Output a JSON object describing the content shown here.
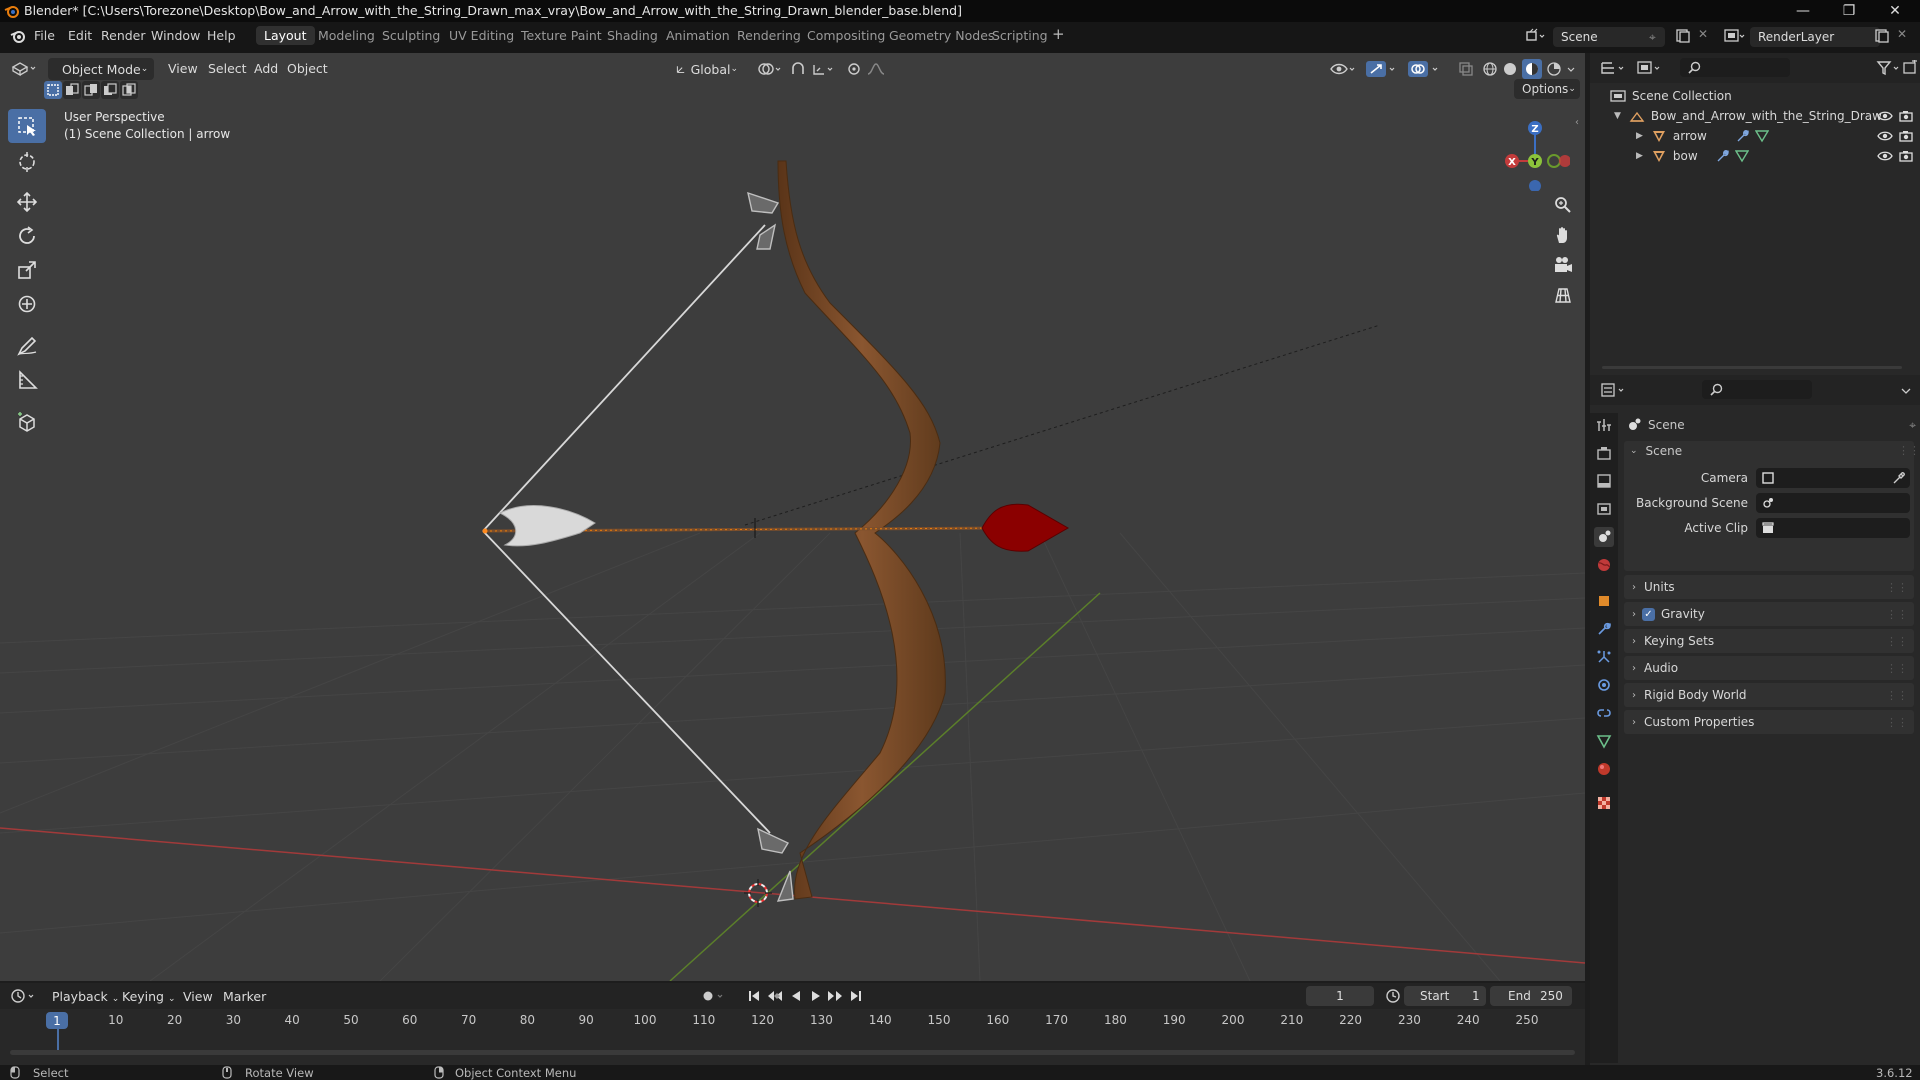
{
  "app": {
    "title": "Blender* [C:\\Users\\Torezone\\Desktop\\Bow_and_Arrow_with_the_String_Drawn_max_vray\\Bow_and_Arrow_with_the_String_Drawn_blender_base.blend]",
    "version": "3.6.12"
  },
  "menu": {
    "file": "File",
    "edit": "Edit",
    "render": "Render",
    "window": "Window",
    "help": "Help"
  },
  "workspaces": [
    "Layout",
    "Modeling",
    "Sculpting",
    "UV Editing",
    "Texture Paint",
    "Shading",
    "Animation",
    "Rendering",
    "Compositing",
    "Geometry Nodes",
    "Scripting"
  ],
  "topbar_right": {
    "scene": "Scene",
    "render_layer": "RenderLayer"
  },
  "viewport": {
    "mode": "Object Mode",
    "menus": {
      "view": "View",
      "select": "Select",
      "add": "Add",
      "object": "Object"
    },
    "transform_orientation": "Global",
    "options": "Options",
    "overlay_line1": "User Perspective",
    "overlay_line2": "(1) Scene Collection | arrow",
    "gizmo": {
      "x": "X",
      "y": "Y",
      "z": "Z"
    }
  },
  "outliner": {
    "root": "Scene Collection",
    "collection": "Bow_and_Arrow_with_the_String_Drawn",
    "objects": [
      "arrow",
      "bow"
    ]
  },
  "properties": {
    "header": "Scene",
    "panel_scene": "Scene",
    "camera_label": "Camera",
    "background_scene_label": "Background Scene",
    "active_clip_label": "Active Clip",
    "panels": [
      "Units",
      "Gravity",
      "Keying Sets",
      "Audio",
      "Rigid Body World",
      "Custom Properties"
    ],
    "gravity_checked": true
  },
  "timeline": {
    "menus": {
      "playback": "Playback",
      "keying": "Keying",
      "view": "View",
      "marker": "Marker"
    },
    "current_frame": "1",
    "start_label": "Start",
    "start": "1",
    "end_label": "End",
    "end": "250",
    "ruler": [
      "10",
      "20",
      "30",
      "40",
      "50",
      "60",
      "70",
      "80",
      "90",
      "100",
      "110",
      "120",
      "130",
      "140",
      "150",
      "160",
      "170",
      "180",
      "190",
      "200",
      "210",
      "220",
      "230",
      "240",
      "250"
    ],
    "playhead": "1"
  },
  "statusbar": {
    "select": "Select",
    "rotate": "Rotate View",
    "context": "Object Context Menu"
  },
  "colors": {
    "accent": "#4a6fa5",
    "axis_x": "#c33b3b",
    "axis_y": "#6a9a2c",
    "axis_z": "#3b6fc3",
    "bow_wood": "#7a4a28",
    "arrow_head": "#8b0000"
  }
}
